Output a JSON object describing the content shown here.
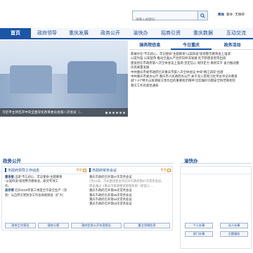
{
  "header": {
    "search_placeholder": "请输入关键词",
    "links": [
      "简体",
      "繁体",
      "无障碍"
    ]
  },
  "nav": {
    "items": [
      "首页",
      "政府领导",
      "重庆发展",
      "政务公开",
      "渝快办",
      "招商引资",
      "重庆数据",
      "互动交流"
    ]
  },
  "banner": {
    "caption": "习近平主持召开中央全面深化改革委员会第八次会议（..."
  },
  "news": {
    "tabs": [
      "国务院信息",
      "今日重庆",
      "政务活动"
    ],
    "lines": [
      "陈敏尔在“不忘初心、牢记使命”主题教育“以案四说”现场警示教育会上强调",
      "以案为鉴 以案促改 推动全面从严治党向纵深发展 杜学新唐良智等出席",
      "唐良智在市政府第八次全体会议上强调 坚定信心 保持定力 真抓实干 奋力推动重",
      "庆高质量发展",
      "中共重庆市委市政府召开重庆市第八次全体会议 中央“两江四岸”治理",
      "中共重庆市委办公厅 重庆市人民政府办公厅 关于深入贯彻习近平总书记对教育",
      "城“7·27”特大山体滑坡灾害作出的重要指示精神 切实做好汛期安全防范和抢险",
      "救灾工作的紧急通知"
    ]
  },
  "zwgk": {
    "title": "政务公开",
    "left": {
      "title": "市政府领导工作动态",
      "more": "更多",
      "rows": [
        {
          "name": "唐良智",
          "text": "出席“不忘初心、牢记使命”主题教育"
        },
        {
          "name": "",
          "text": "“以案四说”现场警示教育会，研究专项工"
        },
        {
          "name": "",
          "text": "作。"
        },
        {
          "name": "吴存荣",
          "text": "召开2019年第三季度全市安全生产（消"
        },
        {
          "name": "",
          "text": "防）与自然灾害防治工作会商视频会（扩大）"
        }
      ]
    },
    "right": {
      "title": "市政府常务会议",
      "more": "更多",
      "rows": [
        "重庆市政府召开第57次常务会议",
        "7月12日，市长唐良智主持召开市政府第57次常务会议，",
        "审议通过《重庆市寄递物流管理条例（草案）》...",
        "重庆市政府召开第56次常务会议",
        "重庆市政府召开第55次常务会议",
        "重庆市政府召开第54次常务会议",
        "重庆市政府召开第53次常务会议"
      ]
    },
    "buttons": [
      "政府工作报告",
      "政府公报",
      "政府信息公开年度报告",
      "重点领域信息"
    ]
  },
  "ykb": {
    "title": "渝快办",
    "buttons": [
      "个人办事",
      "法人办事",
      "部门办事",
      "主题服务"
    ]
  },
  "colors": {
    "brand": "#1a55a8",
    "accent": "#e88a1a"
  }
}
